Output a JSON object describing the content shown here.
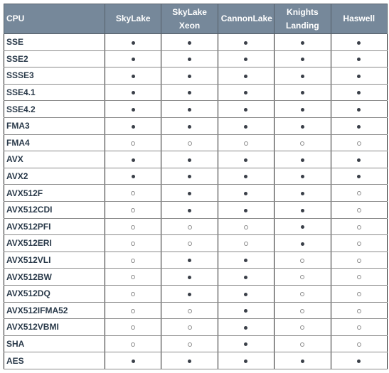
{
  "table": {
    "columns": [
      "CPU",
      "SkyLake",
      "SkyLake Xeon",
      "CannonLake",
      "Knights Landing",
      "Haswell"
    ],
    "header_color": "#76889a",
    "legend": {
      "supported": "filled-dot",
      "unsupported": "hollow-circle"
    },
    "rows": [
      {
        "feature": "SSE",
        "support": [
          true,
          true,
          true,
          true,
          true
        ]
      },
      {
        "feature": "SSE2",
        "support": [
          true,
          true,
          true,
          true,
          true
        ]
      },
      {
        "feature": "SSSE3",
        "support": [
          true,
          true,
          true,
          true,
          true
        ]
      },
      {
        "feature": "SSE4.1",
        "support": [
          true,
          true,
          true,
          true,
          true
        ]
      },
      {
        "feature": "SSE4.2",
        "support": [
          true,
          true,
          true,
          true,
          true
        ]
      },
      {
        "feature": "FMA3",
        "support": [
          true,
          true,
          true,
          true,
          true
        ]
      },
      {
        "feature": "FMA4",
        "support": [
          false,
          false,
          false,
          false,
          false
        ]
      },
      {
        "feature": "AVX",
        "support": [
          true,
          true,
          true,
          true,
          true
        ]
      },
      {
        "feature": "AVX2",
        "support": [
          true,
          true,
          true,
          true,
          true
        ]
      },
      {
        "feature": "AVX512F",
        "support": [
          false,
          true,
          true,
          true,
          false
        ]
      },
      {
        "feature": "AVX512CDI",
        "support": [
          false,
          true,
          true,
          true,
          false
        ]
      },
      {
        "feature": "AVX512PFI",
        "support": [
          false,
          false,
          false,
          true,
          false
        ]
      },
      {
        "feature": "AVX512ERI",
        "support": [
          false,
          false,
          false,
          true,
          false
        ]
      },
      {
        "feature": "AVX512VLI",
        "support": [
          false,
          true,
          true,
          false,
          false
        ]
      },
      {
        "feature": "AVX512BW",
        "support": [
          false,
          true,
          true,
          false,
          false
        ]
      },
      {
        "feature": "AVX512DQ",
        "support": [
          false,
          true,
          true,
          false,
          false
        ]
      },
      {
        "feature": "AVX512IFMA52",
        "support": [
          false,
          false,
          true,
          false,
          false
        ]
      },
      {
        "feature": "AVX512VBMI",
        "support": [
          false,
          false,
          true,
          false,
          false
        ]
      },
      {
        "feature": "SHA",
        "support": [
          false,
          false,
          true,
          false,
          false
        ]
      },
      {
        "feature": "AES",
        "support": [
          true,
          true,
          true,
          true,
          true
        ]
      }
    ]
  }
}
